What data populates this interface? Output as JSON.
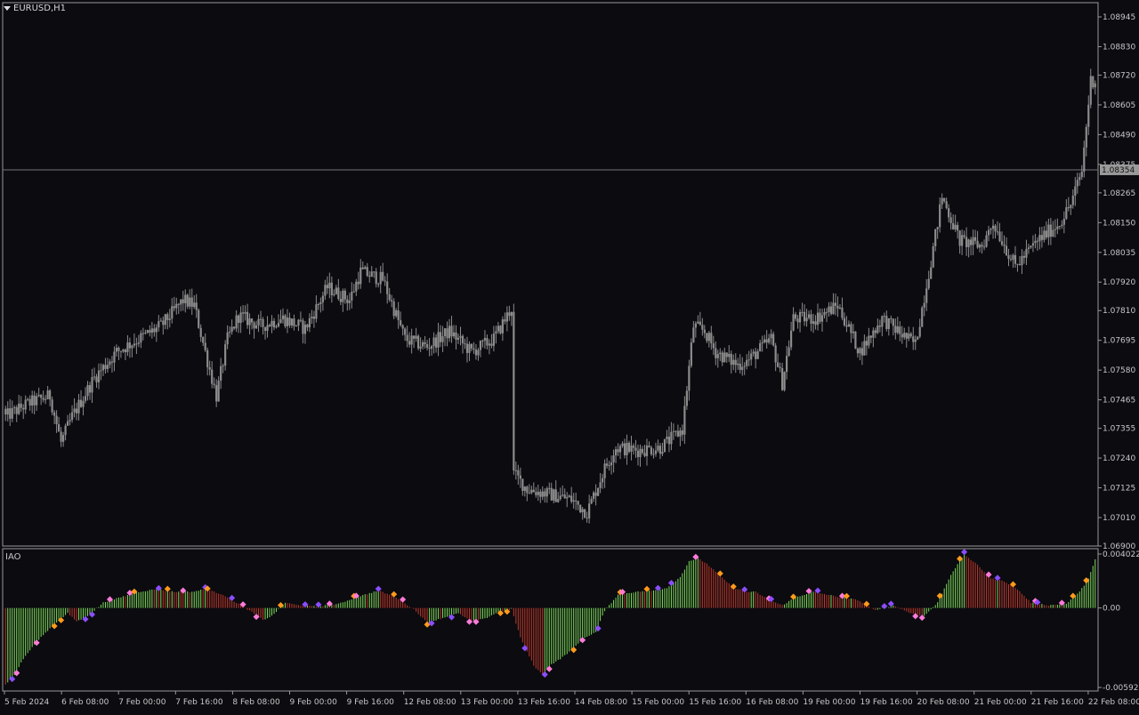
{
  "chart_window": {
    "symbol_label": "EURUSD,H1",
    "indicator_label": "IAO",
    "current_price_label": "1.08354"
  },
  "colors": {
    "background": "#0b0b10",
    "candle": "#8c8c8c",
    "grid_border": "#9a9a9a",
    "ind_up": "#7fdc5a",
    "ind_down": "#c0392b",
    "marker_orange": "#ff9a1a",
    "marker_purple": "#8a4dff",
    "marker_pink": "#ff7ad9"
  },
  "chart_data": [
    {
      "type": "candlestick",
      "title": "EURUSD,H1",
      "ylim": [
        1.069,
        1.09
      ],
      "y_ticks": [
        "1.08945",
        "1.08830",
        "1.08720",
        "1.08605",
        "1.08490",
        "1.08375",
        "1.08265",
        "1.08150",
        "1.08035",
        "1.07920",
        "1.07810",
        "1.07695",
        "1.07580",
        "1.07465",
        "1.07355",
        "1.07240",
        "1.07125",
        "1.07010",
        "1.06900"
      ],
      "x_ticks": [
        "5 Feb 2024",
        "6 Feb 08:00",
        "7 Feb 00:00",
        "7 Feb 16:00",
        "8 Feb 08:00",
        "9 Feb 00:00",
        "9 Feb 16:00",
        "12 Feb 08:00",
        "13 Feb 00:00",
        "13 Feb 16:00",
        "14 Feb 08:00",
        "15 Feb 00:00",
        "15 Feb 16:00",
        "16 Feb 08:00",
        "19 Feb 00:00",
        "19 Feb 16:00",
        "20 Feb 08:00",
        "21 Feb 00:00",
        "21 Feb 16:00",
        "22 Feb 08:00"
      ],
      "current_price": 1.08354,
      "close_anchors": [
        [
          0,
          1.074
        ],
        [
          10,
          1.0745
        ],
        [
          20,
          1.0748
        ],
        [
          25,
          1.073
        ],
        [
          30,
          1.074
        ],
        [
          40,
          1.0755
        ],
        [
          50,
          1.0765
        ],
        [
          60,
          1.077
        ],
        [
          70,
          1.0775
        ],
        [
          80,
          1.0785
        ],
        [
          85,
          1.0783
        ],
        [
          90,
          1.0765
        ],
        [
          95,
          1.0748
        ],
        [
          100,
          1.077
        ],
        [
          105,
          1.0779
        ],
        [
          115,
          1.0775
        ],
        [
          125,
          1.0778
        ],
        [
          135,
          1.0774
        ],
        [
          145,
          1.079
        ],
        [
          155,
          1.0785
        ],
        [
          160,
          1.0796
        ],
        [
          170,
          1.0793
        ],
        [
          180,
          1.077
        ],
        [
          190,
          1.0767
        ],
        [
          200,
          1.0773
        ],
        [
          210,
          1.0765
        ],
        [
          220,
          1.077
        ],
        [
          228,
          1.0782
        ],
        [
          229,
          1.0718
        ],
        [
          235,
          1.0712
        ],
        [
          245,
          1.071
        ],
        [
          255,
          1.0708
        ],
        [
          262,
          1.0703
        ],
        [
          270,
          1.072
        ],
        [
          275,
          1.0728
        ],
        [
          285,
          1.0727
        ],
        [
          295,
          1.0728
        ],
        [
          305,
          1.0735
        ],
        [
          310,
          1.0775
        ],
        [
          315,
          1.0773
        ],
        [
          320,
          1.0765
        ],
        [
          330,
          1.076
        ],
        [
          335,
          1.0762
        ],
        [
          345,
          1.077
        ],
        [
          350,
          1.0753
        ],
        [
          355,
          1.0778
        ],
        [
          365,
          1.0778
        ],
        [
          375,
          1.0783
        ],
        [
          385,
          1.0765
        ],
        [
          395,
          1.0778
        ],
        [
          405,
          1.0771
        ],
        [
          410,
          1.0768
        ],
        [
          418,
          1.0805
        ],
        [
          422,
          1.0825
        ],
        [
          430,
          1.0808
        ],
        [
          440,
          1.0806
        ],
        [
          445,
          1.0815
        ],
        [
          455,
          1.0798
        ],
        [
          465,
          1.0808
        ],
        [
          475,
          1.0815
        ],
        [
          480,
          1.0822
        ],
        [
          485,
          1.0835
        ],
        [
          489,
          1.087
        ]
      ]
    },
    {
      "type": "bar",
      "title": "IAO",
      "ylim": [
        -0.005927,
        0.004022
      ],
      "y_ticks": [
        "0.004022",
        "0.00",
        "-0.005927"
      ],
      "value_anchors": [
        [
          0,
          -0.0057
        ],
        [
          4,
          -0.005
        ],
        [
          8,
          -0.0038
        ],
        [
          14,
          -0.0025
        ],
        [
          22,
          -0.0012
        ],
        [
          28,
          -0.0004
        ],
        [
          32,
          -0.001
        ],
        [
          36,
          -0.0007
        ],
        [
          40,
          -0.0002
        ],
        [
          44,
          0.0004
        ],
        [
          52,
          0.0008
        ],
        [
          60,
          0.0012
        ],
        [
          68,
          0.0014
        ],
        [
          76,
          0.0012
        ],
        [
          84,
          0.0012
        ],
        [
          90,
          0.0014
        ],
        [
          98,
          0.001
        ],
        [
          104,
          0.0004
        ],
        [
          110,
          -0.0002
        ],
        [
          116,
          -0.0009
        ],
        [
          120,
          -0.0006
        ],
        [
          126,
          0.0004
        ],
        [
          132,
          0.0002
        ],
        [
          140,
          0.0001
        ],
        [
          150,
          0.0003
        ],
        [
          158,
          0.0008
        ],
        [
          168,
          0.0013
        ],
        [
          176,
          0.0008
        ],
        [
          184,
          -0.0001
        ],
        [
          190,
          -0.0011
        ],
        [
          196,
          -0.0008
        ],
        [
          204,
          -0.0004
        ],
        [
          210,
          -0.001
        ],
        [
          216,
          -0.0008
        ],
        [
          222,
          -0.0003
        ],
        [
          228,
          -0.0001
        ],
        [
          232,
          -0.0022
        ],
        [
          238,
          -0.0043
        ],
        [
          242,
          -0.005
        ],
        [
          246,
          -0.0042
        ],
        [
          250,
          -0.0038
        ],
        [
          256,
          -0.003
        ],
        [
          260,
          -0.0023
        ],
        [
          266,
          -0.0018
        ],
        [
          270,
          -0.0002
        ],
        [
          276,
          0.001
        ],
        [
          284,
          0.0012
        ],
        [
          292,
          0.0013
        ],
        [
          298,
          0.0015
        ],
        [
          304,
          0.0023
        ],
        [
          308,
          0.0035
        ],
        [
          312,
          0.0037
        ],
        [
          316,
          0.0033
        ],
        [
          322,
          0.0024
        ],
        [
          328,
          0.0015
        ],
        [
          334,
          0.0012
        ],
        [
          338,
          0.0012
        ],
        [
          344,
          0.0006
        ],
        [
          350,
          0.0002
        ],
        [
          356,
          0.0008
        ],
        [
          364,
          0.0012
        ],
        [
          370,
          0.001
        ],
        [
          376,
          0.0008
        ],
        [
          384,
          0.0006
        ],
        [
          392,
          -0.0002
        ],
        [
          400,
          0.0002
        ],
        [
          408,
          -0.0004
        ],
        [
          414,
          -0.0006
        ],
        [
          420,
          0.0004
        ],
        [
          426,
          0.0025
        ],
        [
          432,
          0.004
        ],
        [
          438,
          0.0032
        ],
        [
          444,
          0.0022
        ],
        [
          450,
          0.002
        ],
        [
          456,
          0.0014
        ],
        [
          462,
          0.0004
        ],
        [
          470,
          0.0002
        ],
        [
          478,
          0.0003
        ],
        [
          484,
          0.0012
        ],
        [
          488,
          0.0022
        ],
        [
          491,
          0.0036
        ]
      ]
    }
  ]
}
